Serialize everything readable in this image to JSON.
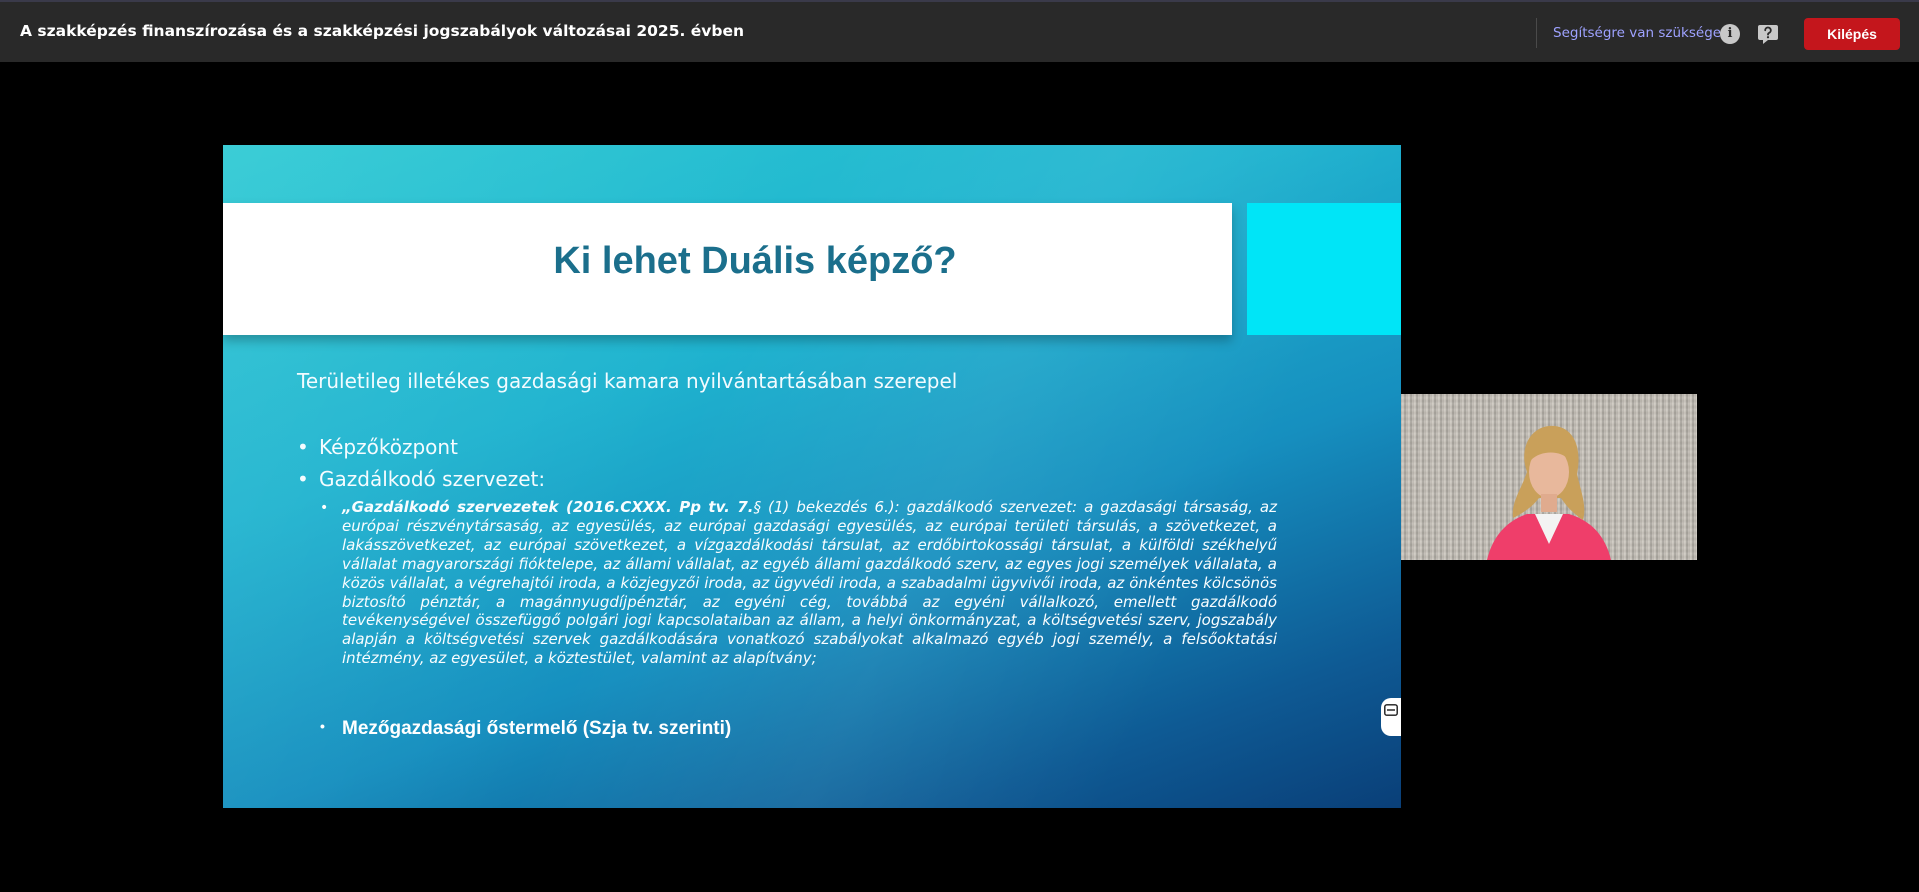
{
  "header": {
    "meeting_title": "A szakképzés finanszírozása és a szakképzési jogszabályok változásai 2025. évben",
    "help_label": "Segítségre van szüksége?",
    "info_icon": "info-icon",
    "help_icon": "question-bubble-icon",
    "exit_label": "Kilépés",
    "exit_color": "#c4161c"
  },
  "slide": {
    "title": "Ki lehet Duális képző?",
    "subtitle": "Területileg illetékes gazdasági kamara nyilvántartásában szerepel",
    "bullets": [
      "Képzőközpont",
      "Gazdálkodó szervezet:"
    ],
    "legal_quote_head": "„Gazdálkodó szervezetek (2016.CXXX. Pp tv. 7.",
    "legal_quote_rest": "§ (1) bekezdés 6.): gazdálkodó szervezet: a gazdasági társaság, az európai részvénytársaság, az egyesülés, az európai gazdasági egyesülés, az európai területi társulás, a szövetkezet, a lakásszövetkezet, az európai szövetkezet, a vízgazdálkodási társulat, az erdőbirtokossági társulat, a külföldi székhelyű vállalat magyarországi fióktelepe, az állami vállalat, az egyéb állami gazdálkodó szerv, az egyes jogi személyek vállalata, a közös vállalat, a végrehajtói iroda, a közjegyzői iroda, az ügyvédi iroda, a szabadalmi ügyvivői iroda, az önkéntes kölcsönös biztosító pénztár, a magánnyugdíjpénztár, az egyéni cég, továbbá az egyéni vállalkozó, emellett gazdálkodó tevékenységével összefüggő polgári jogi kapcsolataiban az állam, a helyi önkormányzat, a költségvetési szerv, jogszabály alapján a költségvetési szervek gazdálkodására vonatkozó szabályokat alkalmazó egyéb jogi személy, a felsőoktatási intézmény, az egyesület, a köztestület, valamint az alapítvány;",
    "farm_bullet": "Mezőgazdasági őstermelő (Szja tv. szerinti)",
    "title_color": "#1b6f8c",
    "accent_color": "#00e5f7"
  },
  "video": {
    "tile_icon": "presenter-video"
  }
}
